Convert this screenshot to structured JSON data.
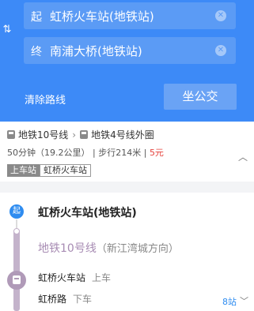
{
  "search": {
    "origin_tag": "起",
    "origin": "虹桥火车站(地铁站)",
    "dest_tag": "终",
    "destination": "南浦大桥(地铁站)",
    "clear_label": "清除路线",
    "bus_button": "坐公交",
    "swap_glyph": "⇅",
    "clear_glyph": "✕"
  },
  "route": {
    "line1": "地铁10号线",
    "arrow": "›",
    "line2": "地铁4号线外圈",
    "duration": "50分钟",
    "distance": "（19.2公里）",
    "separator": "|",
    "walk": "步行214米",
    "price": "5元",
    "board_key": "上车站",
    "board_value": "虹桥火车站",
    "collapse_glyph": "︿"
  },
  "detail": {
    "start_badge": "起",
    "start_name": "虹桥火车站(地铁站)",
    "line_name": "地铁10号线",
    "direction": "（新江湾城方向）",
    "stops": [
      {
        "name": "虹桥火车站",
        "action": "上车"
      },
      {
        "name": "虹桥路",
        "action": "下车"
      }
    ],
    "stop_count": "8站",
    "expand_glyph": "﹀"
  },
  "colors": {
    "header": "#3d8af7",
    "metro_line": "#b09ab8",
    "price": "#e5413b",
    "link": "#2e8cf0"
  }
}
